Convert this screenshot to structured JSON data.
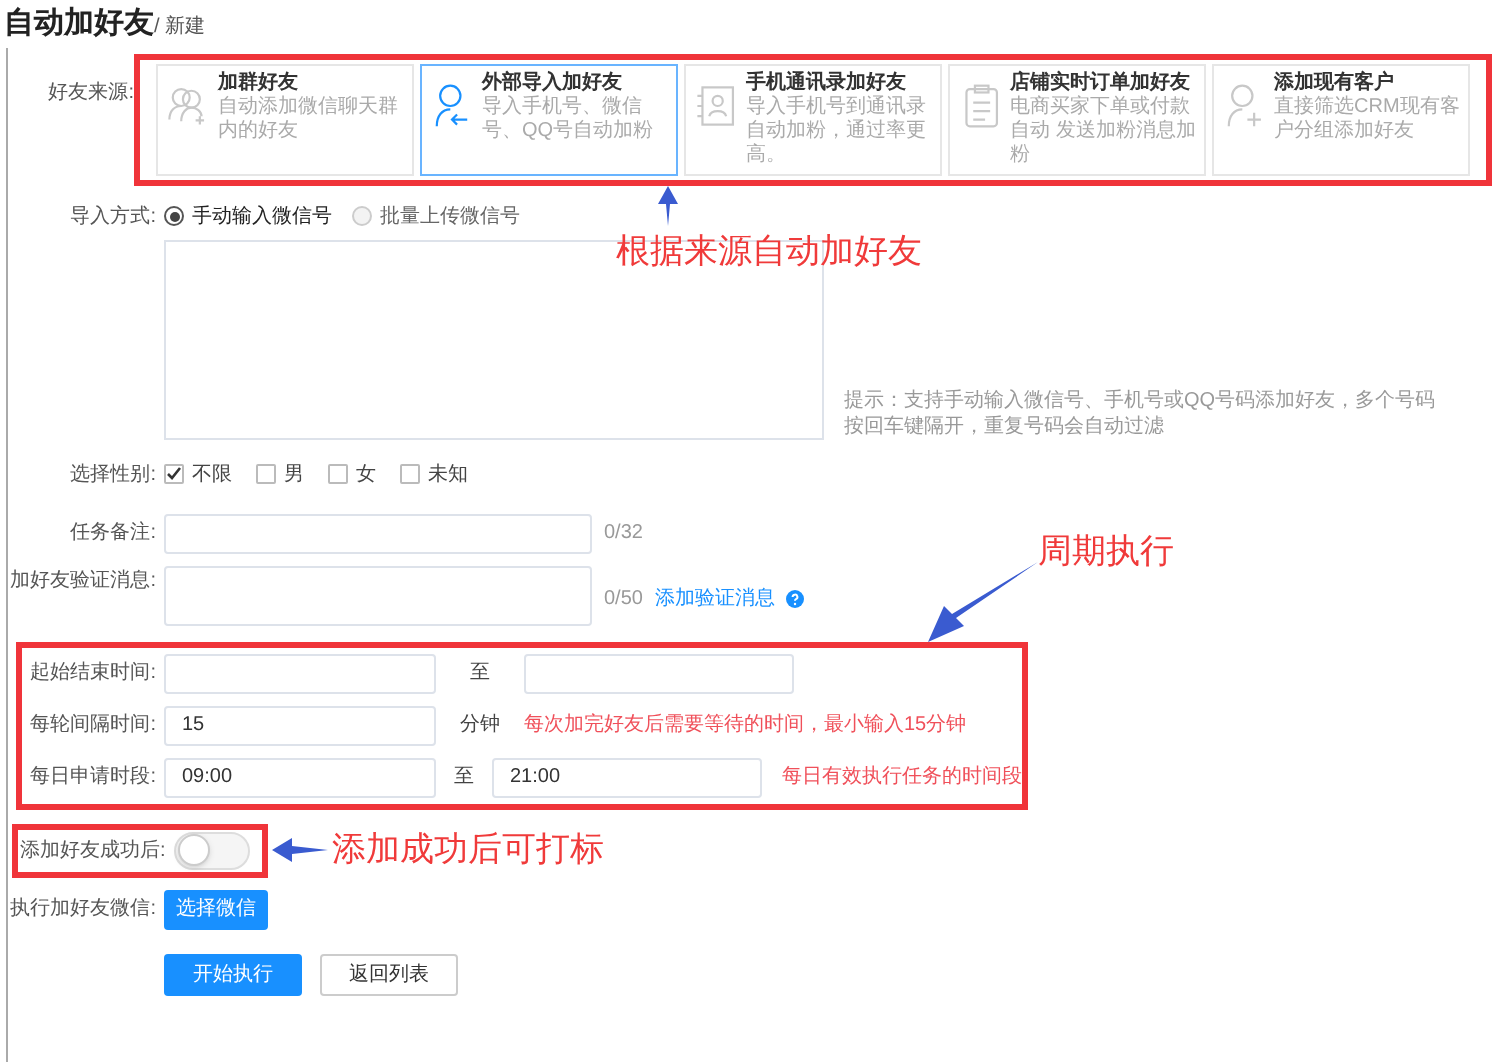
{
  "title": "自动加好友",
  "breadcrumb": "/ 新建",
  "source": {
    "label": "好友来源:",
    "cards": [
      {
        "kind": "group",
        "title": "加群好友",
        "desc": "自动添加微信聊天群内的好友",
        "selected": false
      },
      {
        "kind": "import",
        "title": "外部导入加好友",
        "desc": "导入手机号、微信号、QQ号自动加粉",
        "selected": true
      },
      {
        "kind": "contacts",
        "title": "手机通讯录加好友",
        "desc": "导入手机号到通讯录自动加粉，通过率更高。",
        "selected": false
      },
      {
        "kind": "order",
        "title": "店铺实时订单加好友",
        "desc": "电商买家下单或付款自动 发送加粉消息加粉",
        "selected": false
      },
      {
        "kind": "customer",
        "title": "添加现有客户",
        "desc": "直接筛选CRM现有客户分组添加好友",
        "selected": false
      }
    ]
  },
  "import_method": {
    "label": "导入方式:",
    "options": [
      {
        "label": "手动输入微信号",
        "selected": true
      },
      {
        "label": "批量上传微信号",
        "selected": false
      }
    ],
    "hint": "提示：支持手动输入微信号、手机号或QQ号码添加好友，多个号码按回车键隔开，重复号码会自动过滤"
  },
  "gender": {
    "label": "选择性别:",
    "options": [
      {
        "label": "不限",
        "checked": true
      },
      {
        "label": "男",
        "checked": false
      },
      {
        "label": "女",
        "checked": false
      },
      {
        "label": "未知",
        "checked": false
      }
    ]
  },
  "task_note": {
    "label": "任务备注:",
    "counter": "0/32"
  },
  "verify_message": {
    "label": "加好友验证消息:",
    "counter": "0/50",
    "link": "添加验证消息"
  },
  "schedule": {
    "start_end": {
      "label": "起始结束时间:",
      "separator": "至"
    },
    "interval": {
      "label": "每轮间隔时间:",
      "value": "15",
      "unit": "分钟",
      "hint": "每次加完好友后需要等待的时间，最小输入15分钟"
    },
    "daily": {
      "label": "每日申请时段:",
      "from": "09:00",
      "separator": "至",
      "to": "21:00",
      "hint": "每日有效执行任务的时间段"
    }
  },
  "tag_after_success": {
    "label": "添加好友成功后:",
    "on": false
  },
  "execute_wechat": {
    "label": "执行加好友微信:",
    "button": "选择微信"
  },
  "actions": [
    {
      "label": "开始执行",
      "kind": "primary"
    },
    {
      "label": "返回列表",
      "kind": "secondary"
    }
  ],
  "annotations": [
    "根据来源自动加好友",
    "周期执行",
    "添加成功后可打标"
  ]
}
